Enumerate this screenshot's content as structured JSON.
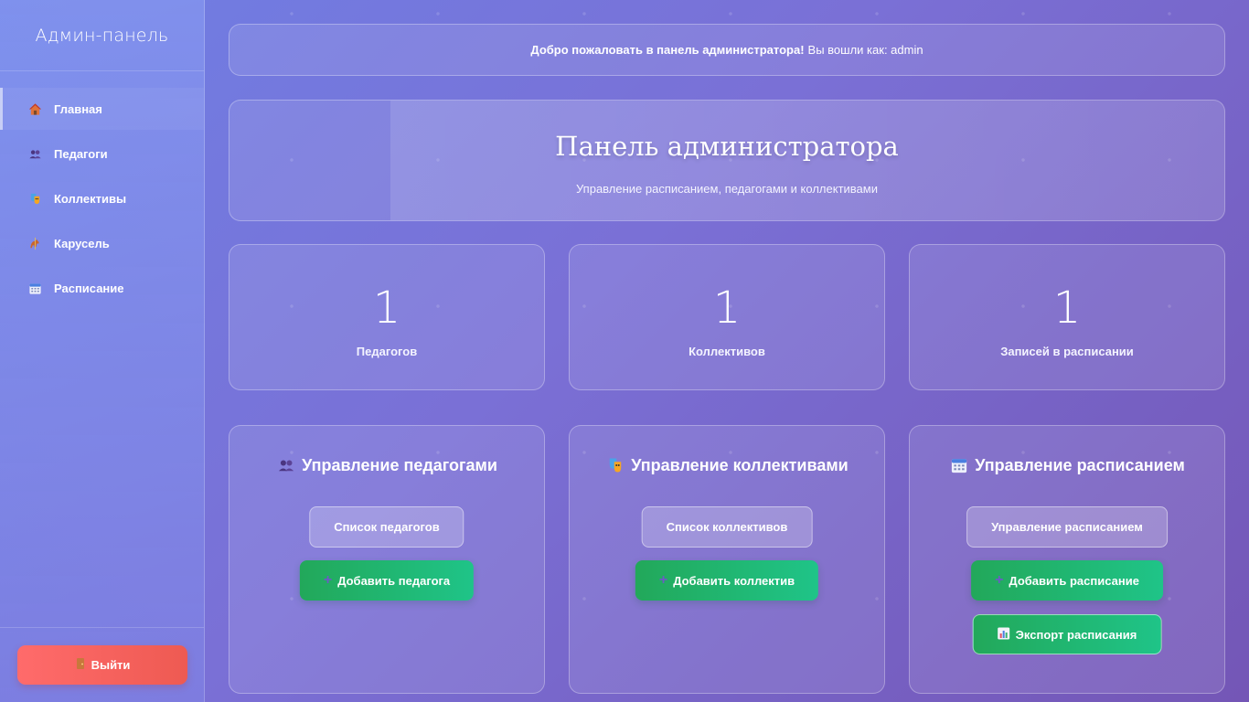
{
  "sidebar": {
    "title": "Админ-панель",
    "items": [
      {
        "label": "Главная",
        "icon": "house-icon"
      },
      {
        "label": "Педагоги",
        "icon": "people-icon"
      },
      {
        "label": "Коллективы",
        "icon": "theater-masks-icon"
      },
      {
        "label": "Карусель",
        "icon": "carousel-horse-icon"
      },
      {
        "label": "Расписание",
        "icon": "calendar-icon"
      }
    ],
    "active_index": 0,
    "logout_label": "Выйти"
  },
  "welcome": {
    "bold": "Добро пожаловать в панель администратора!",
    "text": "Вы вошли как: admin"
  },
  "hero": {
    "title": "Панель администратора",
    "subtitle": "Управление расписанием, педагогами и коллективами"
  },
  "stats": [
    {
      "value": "1",
      "label": "Педагогов"
    },
    {
      "value": "1",
      "label": "Коллективов"
    },
    {
      "value": "1",
      "label": "Записей в расписании"
    }
  ],
  "sections": {
    "teachers": {
      "title": "Управление педагогами",
      "icon": "people-icon",
      "list_button": "Список педагогов",
      "add_button": "Добавить педагога"
    },
    "groups": {
      "title": "Управление коллективами",
      "icon": "theater-masks-icon",
      "list_button": "Список коллективов",
      "add_button": "Добавить коллектив"
    },
    "schedule": {
      "title": "Управление расписанием",
      "icon": "calendar-icon",
      "list_button": "Управление расписанием",
      "add_button": "Добавить расписание",
      "export_button": "Экспорт расписания"
    }
  },
  "colors": {
    "accent_green": "#22a85a",
    "logout_red": "#ff6b6b",
    "background": "#7a70d6"
  }
}
